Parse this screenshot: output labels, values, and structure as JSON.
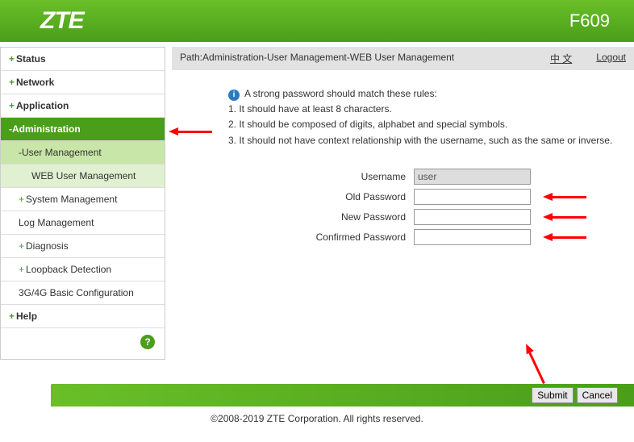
{
  "header": {
    "logo": "ZTE",
    "model": "F609"
  },
  "sidebar": {
    "status": "Status",
    "network": "Network",
    "application": "Application",
    "administration": "Administration",
    "user_mgmt": "-User Management",
    "web_user_mgmt": "WEB User Management",
    "system_mgmt": "System Management",
    "log_mgmt": "Log Management",
    "diagnosis": "Diagnosis",
    "loopback": "Loopback Detection",
    "g3g4g": "3G/4G Basic Configuration",
    "help": "Help"
  },
  "pathbar": {
    "path": "Path:Administration-User Management-WEB User Management",
    "lang": "中 文",
    "logout": "Logout"
  },
  "info": {
    "title": "A strong password should match these rules:",
    "rule1": "1. It should have at least 8 characters.",
    "rule2": "2. It should be composed of digits, alphabet and special symbols.",
    "rule3": "3. It should not have context relationship with the username, such as the same or inverse."
  },
  "form": {
    "username_label": "Username",
    "username_value": "user",
    "old_pw_label": "Old Password",
    "new_pw_label": "New Password",
    "confirm_pw_label": "Confirmed Password"
  },
  "buttons": {
    "submit": "Submit",
    "cancel": "Cancel"
  },
  "footer": "©2008-2019 ZTE Corporation. All rights reserved."
}
